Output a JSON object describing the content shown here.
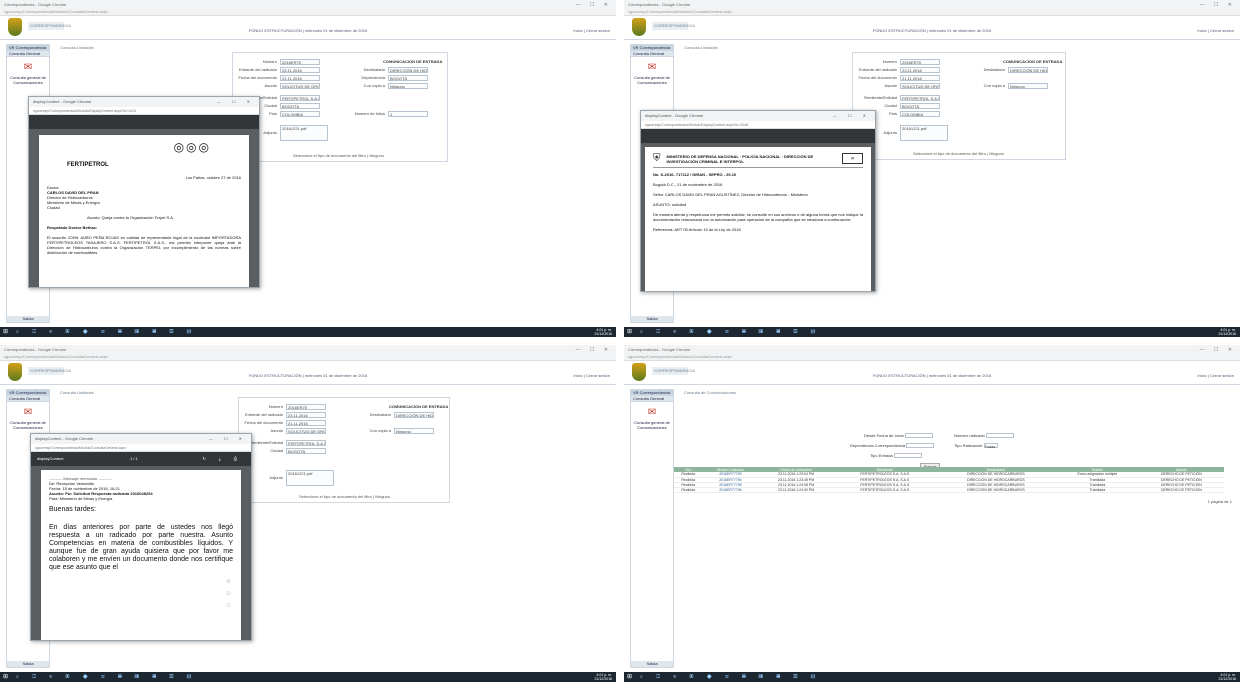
{
  "app": {
    "brand": "CORRESPONDENCIA",
    "subtitle": "FONDO ESTRUCTURACIÓN | miércoles 01 de diciembre de 2016",
    "header_links": "Inicio | Cerrar sesión",
    "breadcrumb": "Consulta Unidades",
    "nav_tabs": [
      "VR Correspondencia",
      "Consulta General"
    ],
    "nav_label": "Consulta general de Comunicaciones",
    "nav_footer": "Salida"
  },
  "chrome": {
    "tab_title": "Correspondencia - Google Chrome",
    "address": "sgcorresp/Correspondencia/Modulo/ConsultaGeneral.aspx"
  },
  "form": {
    "title": "COMUNICACION DE ENTRADA",
    "labels": [
      "Número",
      "Entrante del radicado",
      "Fecha del documento",
      "Asunto",
      "Remitente/Entidad",
      "Ciudad",
      "País",
      "Número de folios",
      "Adjunto",
      "Destinatario",
      "Dependencia",
      "Con copia a"
    ],
    "values": [
      "2016ER75",
      "23.11.2016",
      "21.11.2016",
      "SOLICITUD DE ORGANIZACIÓN",
      "FERTIPETROL S.A.S",
      "BOGOTÁ",
      "COLOMBIA",
      "1",
      "20161221.pdf",
      "DIRECCIÓN DE HIDROCARBUROS",
      "BOGOTÁ",
      "Ninguno"
    ],
    "link": "Seleccione el tipo de documento del filtro | Ninguno"
  },
  "popup1": {
    "title": "displayContent - Google Chrome",
    "address": "sgcorresp/Correspondencia/Modulo/DisplayContent.aspx?id=1024",
    "date_line": "Los Patios, octubre 27 de 2016",
    "greeting": "Doctor",
    "addressee": "CARLOS DAVID DEL PRAN",
    "role1": "Director de Hidrocarburos",
    "role2": "Ministerio de Minas y Energía",
    "city": "Ciudad",
    "subject": "Asunto: Queja contra la Organización Terpel S.A.",
    "salute": "Respetado Doctor Bethas:",
    "body": "El suscrito JOHN JAIRO PEÑA ROJAS en calidad de representante legal de la sociedad IMPORTADORA FERTIPETROLEOS TASAJERO S.A.S. FERTIPETROL S.A.S., me permito interponer queja ante la Dirección de Hidrocarburos contra la Organización TERPEL por incumplimiento de las normas sobre distribución de combustibles",
    "logo_text": "FERTIPETROL"
  },
  "popup2": {
    "title": "displayContent - Google Chrome",
    "address": "sgcorresp/Correspondencia/Modulo/DisplayContent.aspx?id=2048",
    "header": "MINISTERIO DE DEFENSA NACIONAL · POLICÍA NACIONAL · DIRECCIÓN DE INVESTIGACIÓN CRIMINAL E INTERPOL",
    "ref": "No. S-2016- 717112 / DIRAN - SEPRO - 29.10",
    "date_line": "Bogotá D.C., 21 de noviembre de 2016",
    "to": "Señor CARLOS DAVID DEL PRAN AGUSTÍNEZ, Director de Hidrocarburos - Ministerio",
    "asunto": "ASUNTO: solicitud",
    "body": "De manera atenta y respetuosa me permito solicitar, se consulte en sus archivos o de alguna forma que nos indique la documentación relacionada con la autorización para operación de la compañía que se relaciona a continuación:",
    "ref2": "Referencia: ART 05 Artículo 15 de la Ley de 2016"
  },
  "popup3": {
    "title": "displayContent - Google Chrome",
    "toolbar_title": "displayContent",
    "pages": "1 / 1",
    "forward": "---------- Mensaje reenviado ----------",
    "from": "De: Recepción Ventanilla",
    "date": "Fecha: 15 de noviembre de 2016, 16:21",
    "subject": "Asunto: Fw: Solicitud Respuesta radicado 2016048294",
    "to": "Para: Ministerio de Minas y Energía",
    "greeting": "Buenas tardes:",
    "body": "En días anteriores por parte de ustedes nos llegó respuesta a un radicado por parte nuestra. Asunto Competencias en materia de combustibles líquidos. Y aunque fue de gran ayuda quisiera que por favor me colaboren y me envíen un documento donde nos certifique que ese asunto que el"
  },
  "search": {
    "title": "Consulta de Comunicaciones",
    "fields": [
      "Desde Fecha de Inicio",
      "Hasta Fecha Final",
      "Dependencia Correspondencia",
      "Tipo Entrada",
      "Número radicado",
      "Tipo Radicación"
    ],
    "selects": [
      "Todas",
      "Todos"
    ],
    "button": "Buscar"
  },
  "results": {
    "headers": [
      "Tipo",
      "Número radicado",
      "Fecha de radicación",
      "Remitente",
      "Destinatario",
      "Estado",
      "Asunto"
    ],
    "rows": [
      [
        "Recibida",
        "2016ER77793",
        "23.11.2016 1:23:04 PM",
        "FERTIPETROLEOS S.A. S.A.S",
        "DIRECCIÓN DE HIDROCARBUROS",
        "Envío asignación múltiple",
        "DERECHO DE PETICIÓN"
      ],
      [
        "Recibida",
        "2016ER77794",
        "23.11.2016 1:23:45 PM",
        "FERTIPETROLEOS S.A. S.A.S",
        "DIRECCIÓN DE HIDROCARBUROS",
        "Tramitada",
        "DERECHO DE PETICIÓN"
      ],
      [
        "Recibida",
        "2016ER77795",
        "23.11.2016 1:24:08 PM",
        "FERTIPETROLEOS S.A. S.A.S",
        "DIRECCIÓN DE HIDROCARBUROS",
        "Tramitada",
        "DERECHO DE PETICIÓN"
      ],
      [
        "Recibida",
        "2016ER77796",
        "23.11.2016 1:24:30 PM",
        "FERTIPETROLEOS S.A. S.A.S",
        "DIRECCIÓN DE HIDROCARBUROS",
        "Tramitada",
        "DERECHO DE PETICIÓN"
      ]
    ],
    "pager": "1 página de 1"
  },
  "taskbar": {
    "start": "⊞",
    "apps": "⌕ ◫ e ▣ ◆ ✉ ▤ ▥ ▦ ▧ ▨",
    "time": "4:01 p. m.",
    "date": "21/12/2016"
  },
  "colors": {
    "accent": "#8fb59a",
    "nav_bg": "#dfe7ee",
    "taskbar": "#1d2731",
    "pdf_toolbar": "#323639"
  }
}
